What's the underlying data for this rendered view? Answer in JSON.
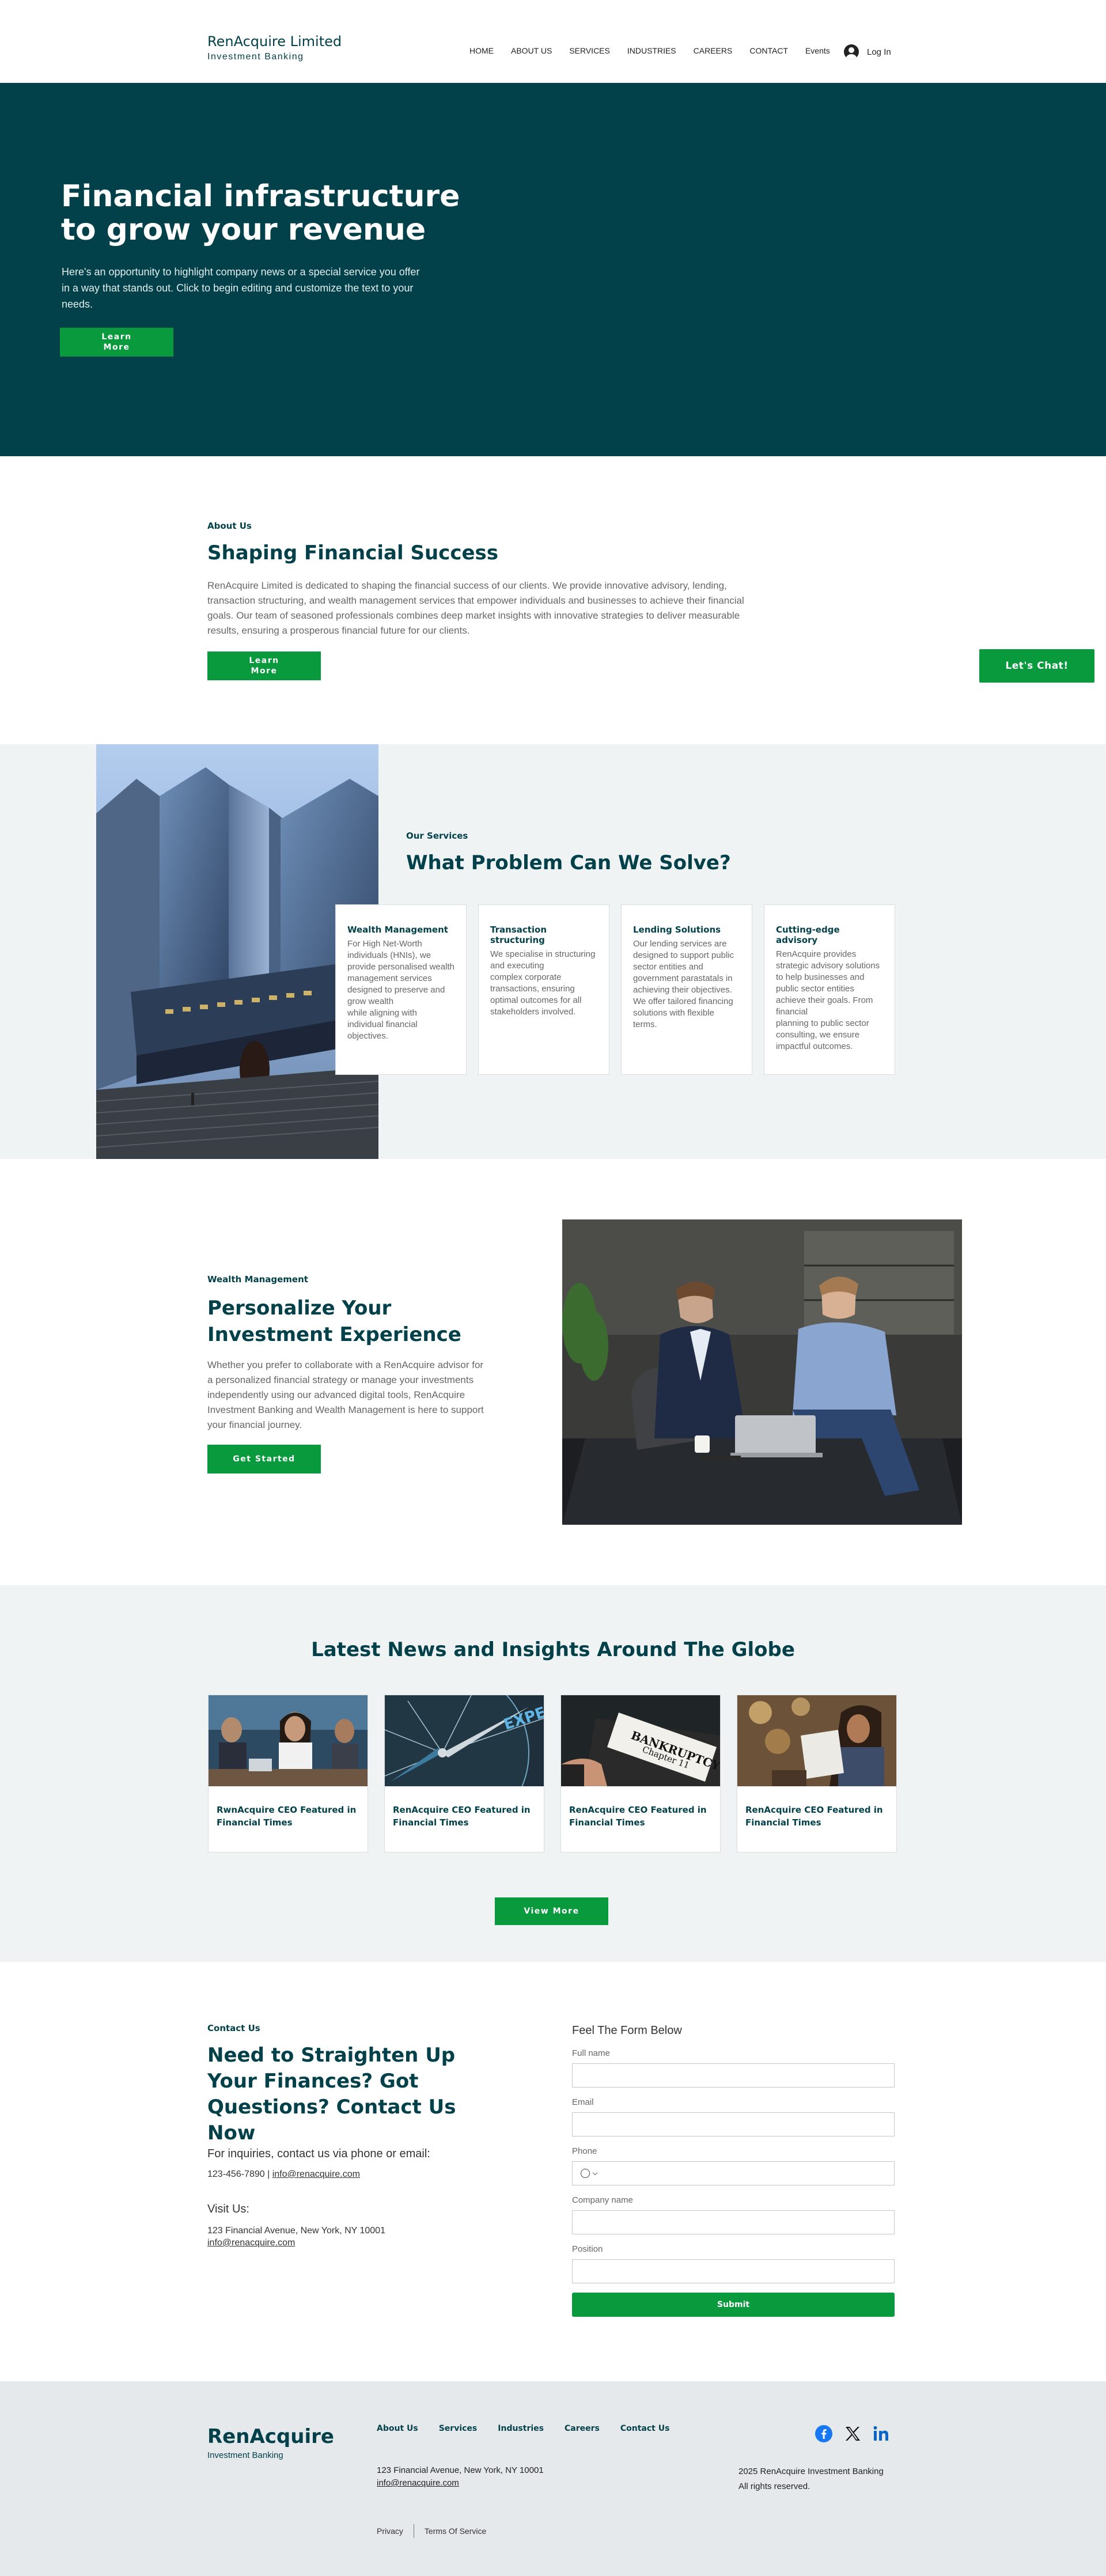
{
  "header": {
    "brand_name": "RenAcquire Limited",
    "brand_sub": "Investment Banking",
    "nav": [
      "HOME",
      "ABOUT US",
      "SERVICES",
      "INDUSTRIES",
      "CAREERS",
      "CONTACT",
      "Events"
    ],
    "login": "Log In"
  },
  "hero": {
    "title": "Financial infrastructure to grow your revenue",
    "text": "Here's an opportunity to highlight company news or a special service you offer in a way that stands out. Click to begin editing and customize the text to your needs.",
    "button": "Learn More"
  },
  "about": {
    "eyebrow": "About Us",
    "title": "Shaping Financial Success",
    "text": "RenAcquire Limited is dedicated to shaping the financial success of our clients. We provide innovative advisory, lending, transaction structuring, and wealth management services that empower individuals and businesses to achieve their financial goals. Our team of seasoned professionals combines deep market insights with innovative strategies to deliver measurable results, ensuring a prosperous financial future for our clients.",
    "button": "Learn More",
    "chat_button": "Let's Chat!"
  },
  "services": {
    "eyebrow": "Our Services",
    "title": "What Problem Can We Solve?",
    "cards": [
      {
        "title": "Wealth Management",
        "text": "For High Net-Worth individuals (HNIs), we provide personalised wealth management services designed to preserve and grow wealth\nwhile aligning with individual financial objectives."
      },
      {
        "title": "Transaction structuring",
        "text": "We specialise in structuring and executing\ncomplex corporate transactions, ensuring optimal outcomes for all stakeholders involved."
      },
      {
        "title": "Lending Solutions",
        "text": "Our lending services are designed to support public sector entities and government parastatals in achieving their objectives.\nWe offer tailored financing solutions with flexible terms."
      },
      {
        "title": "Cutting-edge advisory",
        "text": "RenAcquire provides strategic advisory solutions to help businesses and public sector entities achieve their goals. From financial\nplanning to public sector consulting, we ensure impactful outcomes."
      }
    ]
  },
  "wealth": {
    "eyebrow": "Wealth Management",
    "title": "Personalize Your Investment Experience",
    "text": "Whether you prefer to collaborate with a RenAcquire advisor for a personalized financial strategy or manage your investments independently using our advanced digital tools, RenAcquire Investment Banking and Wealth Management is here to support your financial journey.",
    "button": "Get Started"
  },
  "news": {
    "title": "Latest News and Insights Around The Globe",
    "cards": [
      {
        "title": "RwnAcquire CEO Featured in Financial Times"
      },
      {
        "title": "RenAcquire CEO Featured in Financial Times",
        "image_text": "EXPERT"
      },
      {
        "title": "RenAcquire CEO Featured in Financial Times",
        "image_text": "BANKRUPTCY",
        "image_text_2": "Chapter 11"
      },
      {
        "title": "RenAcquire CEO Featured in Financial Times"
      }
    ],
    "button": "View More"
  },
  "contact": {
    "eyebrow": "Contact Us",
    "title": "Need to Straighten Up Your Finances? Got Questions? Contact Us Now",
    "inquiries": "For inquiries, contact us via phone or email:",
    "phone": "123-456-7890",
    "phone_sep": " | ",
    "email": "info@renacquire.com",
    "visit": "Visit Us:",
    "address": "123 Financial Avenue, New York, NY 10001",
    "address_email": "info@renacquire.com",
    "form_title": "Feel The Form Below",
    "fields": {
      "full_name": "Full name",
      "email": "Email",
      "phone": "Phone",
      "company": "Company name",
      "position": "Position"
    },
    "phone_prefix_icon": "globe-icon",
    "submit": "Submit"
  },
  "footer": {
    "brand": "RenAcquire",
    "brand_sub": "Investment Banking",
    "links": [
      "About Us",
      "Services",
      "Industries",
      "Careers",
      "Contact Us"
    ],
    "address": "123 Financial Avenue, New York, NY 10001",
    "email": "info@renacquire.com",
    "copyright": "2025 RenAcquire Investment Banking",
    "rights": "All rights reserved.",
    "social": [
      "facebook-icon",
      "x-icon",
      "linkedin-icon"
    ],
    "legal": [
      "Privacy",
      "Terms Of Service"
    ]
  },
  "colors": {
    "brand_teal": "#02414a",
    "accent_green": "#0a9a3e",
    "section_gray": "#f0f3f4",
    "footer_gray": "#e5e9eb"
  }
}
